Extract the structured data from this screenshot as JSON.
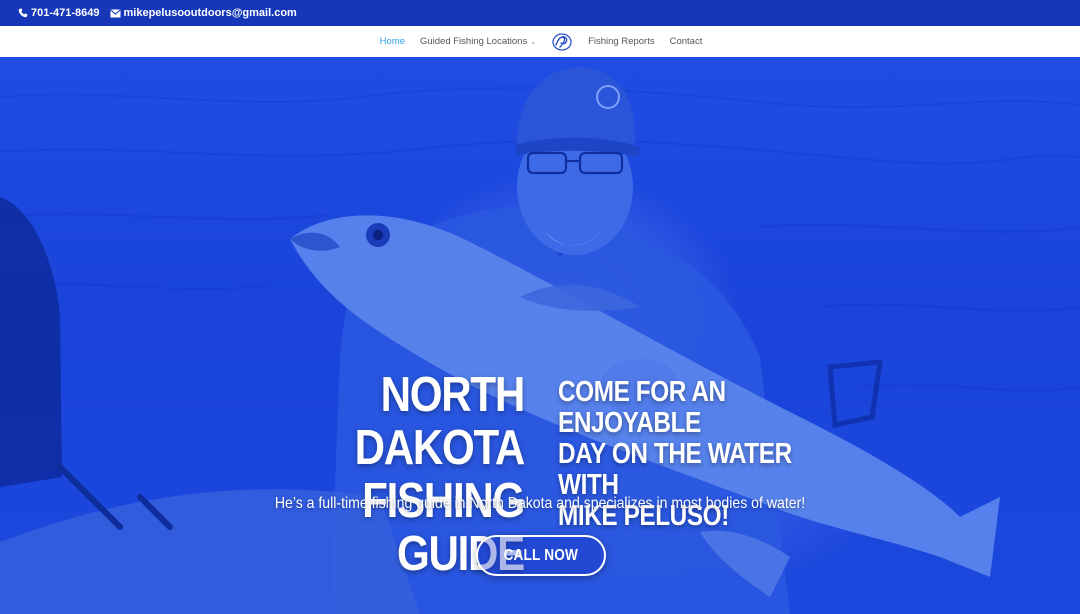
{
  "topbar": {
    "phone": "701-471-8649",
    "email": "mikepelusooutdoors@gmail.com",
    "phone_icon": "phone-icon",
    "email_icon": "envelope-icon"
  },
  "nav": {
    "items": [
      {
        "label": "Home",
        "active": true
      },
      {
        "label": "Guided Fishing Locations",
        "has_dropdown": true
      },
      {
        "label": "Fishing Reports"
      },
      {
        "label": "Contact"
      }
    ],
    "logo_icon": "site-logo-icon",
    "active_color": "#2ea3f2"
  },
  "hero": {
    "title_line1": "NORTH DAKOTA",
    "title_line2": "FISHING GUIDE",
    "tagline_line1": "COME FOR AN ENJOYABLE",
    "tagline_line2": "DAY ON THE WATER WITH",
    "tagline_line3": "MIKE PELUSO!",
    "subtitle": "He’s a full-time fishing guide in North Dakota and specializes in most bodies of water!",
    "cta_label": "CALL NOW",
    "overlay_color": "#1a44da"
  }
}
